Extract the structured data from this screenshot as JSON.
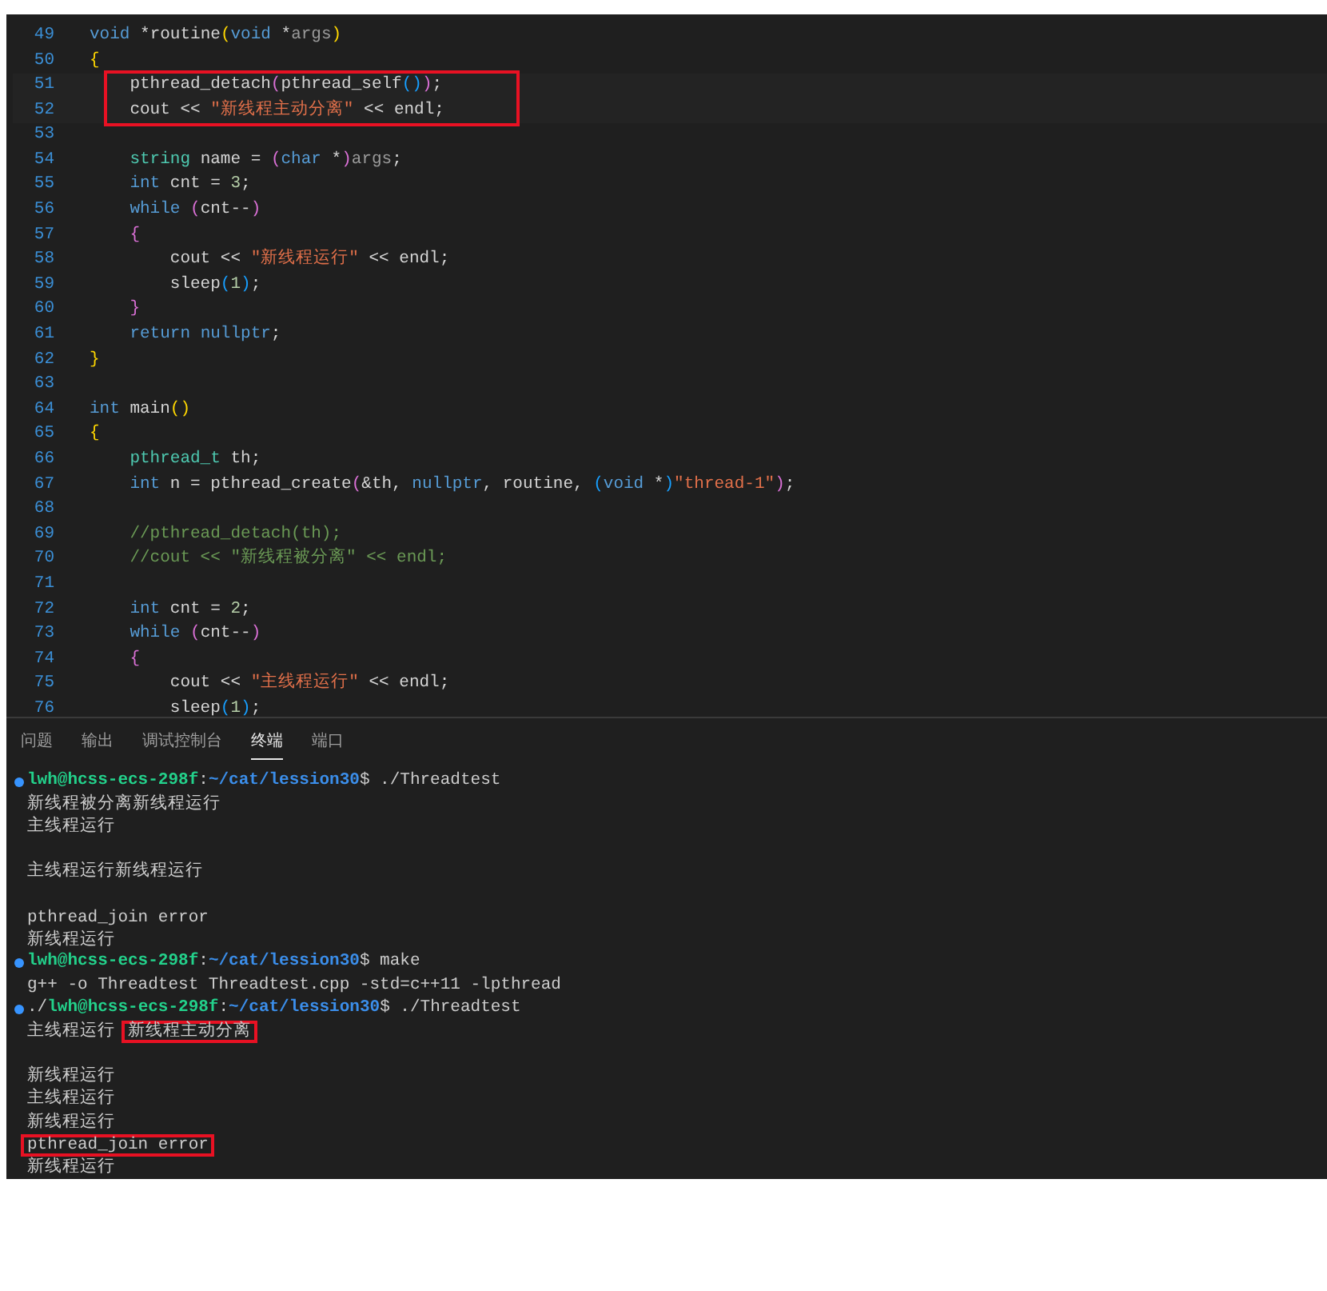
{
  "editor": {
    "lines": [
      {
        "number": "49",
        "tokens": [
          {
            "text": "void",
            "kind": "k"
          },
          {
            "text": " *routine",
            "kind": "p"
          },
          {
            "text": "(",
            "kind": "y"
          },
          {
            "text": "void",
            "kind": "k"
          },
          {
            "text": " *",
            "kind": "p"
          },
          {
            "text": "args",
            "kind": "d"
          },
          {
            "text": ")",
            "kind": "y"
          }
        ]
      },
      {
        "number": "50",
        "tokens": [
          {
            "text": "{",
            "kind": "y"
          }
        ]
      },
      {
        "number": "51",
        "highlighted": true,
        "tokens": [
          {
            "text": "    pthread_detach",
            "kind": "p"
          },
          {
            "text": "(",
            "kind": "m"
          },
          {
            "text": "pthread_self",
            "kind": "p"
          },
          {
            "text": "()",
            "kind": "b"
          },
          {
            "text": ")",
            "kind": "m"
          },
          {
            "text": ";",
            "kind": "p"
          }
        ]
      },
      {
        "number": "52",
        "highlighted": true,
        "tokens": [
          {
            "text": "    cout << ",
            "kind": "p"
          },
          {
            "text": "\"新线程主动分离\"",
            "kind": "s"
          },
          {
            "text": " << endl;",
            "kind": "p"
          }
        ]
      },
      {
        "number": "53"
      },
      {
        "number": "54",
        "tokens": [
          {
            "text": "    string",
            "kind": "t"
          },
          {
            "text": " name = ",
            "kind": "p"
          },
          {
            "text": "(",
            "kind": "m"
          },
          {
            "text": "char",
            "kind": "k"
          },
          {
            "text": " *",
            "kind": "p"
          },
          {
            "text": ")",
            "kind": "m"
          },
          {
            "text": "args",
            "kind": "d"
          },
          {
            "text": ";",
            "kind": "p"
          }
        ]
      },
      {
        "number": "55",
        "tokens": [
          {
            "text": "    int",
            "kind": "k"
          },
          {
            "text": " cnt = ",
            "kind": "p"
          },
          {
            "text": "3",
            "kind": "n"
          },
          {
            "text": ";",
            "kind": "p"
          }
        ]
      },
      {
        "number": "56",
        "tokens": [
          {
            "text": "    while ",
            "kind": "k"
          },
          {
            "text": "(",
            "kind": "m"
          },
          {
            "text": "cnt--",
            "kind": "p"
          },
          {
            "text": ")",
            "kind": "m"
          }
        ]
      },
      {
        "number": "57",
        "tokens": [
          {
            "text": "    {",
            "kind": "m"
          }
        ]
      },
      {
        "number": "58",
        "tokens": [
          {
            "text": "        cout << ",
            "kind": "p"
          },
          {
            "text": "\"新线程运行\"",
            "kind": "s"
          },
          {
            "text": " << endl;",
            "kind": "p"
          }
        ]
      },
      {
        "number": "59",
        "tokens": [
          {
            "text": "        sleep",
            "kind": "p"
          },
          {
            "text": "(",
            "kind": "b"
          },
          {
            "text": "1",
            "kind": "n"
          },
          {
            "text": ")",
            "kind": "b"
          },
          {
            "text": ";",
            "kind": "p"
          }
        ]
      },
      {
        "number": "60",
        "tokens": [
          {
            "text": "    }",
            "kind": "m"
          }
        ]
      },
      {
        "number": "61",
        "tokens": [
          {
            "text": "    return ",
            "kind": "k"
          },
          {
            "text": "nullptr",
            "kind": "k"
          },
          {
            "text": ";",
            "kind": "p"
          }
        ]
      },
      {
        "number": "62",
        "tokens": [
          {
            "text": "}",
            "kind": "y"
          }
        ]
      },
      {
        "number": "63"
      },
      {
        "number": "64",
        "tokens": [
          {
            "text": "int",
            "kind": "k"
          },
          {
            "text": " main",
            "kind": "p"
          },
          {
            "text": "()",
            "kind": "y"
          }
        ]
      },
      {
        "number": "65",
        "tokens": [
          {
            "text": "{",
            "kind": "y"
          }
        ]
      },
      {
        "number": "66",
        "tokens": [
          {
            "text": "    pthread_t",
            "kind": "t"
          },
          {
            "text": " th;",
            "kind": "p"
          }
        ]
      },
      {
        "number": "67",
        "tokens": [
          {
            "text": "    int",
            "kind": "k"
          },
          {
            "text": " n = pthread_create",
            "kind": "p"
          },
          {
            "text": "(",
            "kind": "m"
          },
          {
            "text": "&th, ",
            "kind": "p"
          },
          {
            "text": "nullptr",
            "kind": "k"
          },
          {
            "text": ", routine, ",
            "kind": "p"
          },
          {
            "text": "(",
            "kind": "b"
          },
          {
            "text": "void",
            "kind": "k"
          },
          {
            "text": " *",
            "kind": "p"
          },
          {
            "text": ")",
            "kind": "b"
          },
          {
            "text": "\"thread-1\"",
            "kind": "s"
          },
          {
            "text": ")",
            "kind": "m"
          },
          {
            "text": ";",
            "kind": "p"
          }
        ]
      },
      {
        "number": "68"
      },
      {
        "number": "69",
        "tokens": [
          {
            "text": "    //pthread_detach(th);",
            "kind": "c"
          }
        ]
      },
      {
        "number": "70",
        "tokens": [
          {
            "text": "    //cout << \"新线程被分离\" << endl;",
            "kind": "c"
          }
        ]
      },
      {
        "number": "71"
      },
      {
        "number": "72",
        "tokens": [
          {
            "text": "    int",
            "kind": "k"
          },
          {
            "text": " cnt = ",
            "kind": "p"
          },
          {
            "text": "2",
            "kind": "n"
          },
          {
            "text": ";",
            "kind": "p"
          }
        ]
      },
      {
        "number": "73",
        "tokens": [
          {
            "text": "    while ",
            "kind": "k"
          },
          {
            "text": "(",
            "kind": "m"
          },
          {
            "text": "cnt--",
            "kind": "p"
          },
          {
            "text": ")",
            "kind": "m"
          }
        ]
      },
      {
        "number": "74",
        "tokens": [
          {
            "text": "    {",
            "kind": "m"
          }
        ]
      },
      {
        "number": "75",
        "tokens": [
          {
            "text": "        cout << ",
            "kind": "p"
          },
          {
            "text": "\"主线程运行\"",
            "kind": "s"
          },
          {
            "text": " << endl;",
            "kind": "p"
          }
        ]
      },
      {
        "number": "76",
        "tokens": [
          {
            "text": "        sleep",
            "kind": "p"
          },
          {
            "text": "(",
            "kind": "b"
          },
          {
            "text": "1",
            "kind": "n"
          },
          {
            "text": ")",
            "kind": "b"
          },
          {
            "text": ";",
            "kind": "p"
          }
        ]
      }
    ]
  },
  "panel_tabs": [
    {
      "label": "问题",
      "selected": false
    },
    {
      "label": "输出",
      "selected": false
    },
    {
      "label": "调试控制台",
      "selected": false
    },
    {
      "label": "终端",
      "selected": true
    },
    {
      "label": "端口",
      "selected": false
    }
  ],
  "terminal": {
    "lines": [
      {
        "kind": "prompt",
        "user": "lwh@hcss-ecs-298f",
        "separator": ":",
        "path": "~/cat/lession30",
        "command": "$ ./Threadtest"
      },
      {
        "kind": "output",
        "segments": [
          {
            "text": "新线程被分离新线程运行",
            "boxed": false
          }
        ]
      },
      {
        "kind": "output",
        "segments": [
          {
            "text": "主线程运行",
            "boxed": false
          }
        ]
      },
      {
        "kind": "blank"
      },
      {
        "kind": "output",
        "segments": [
          {
            "text": "主线程运行新线程运行",
            "boxed": false
          }
        ]
      },
      {
        "kind": "blank"
      },
      {
        "kind": "output",
        "segments": [
          {
            "text": "pthread_join error",
            "boxed": false
          }
        ]
      },
      {
        "kind": "output",
        "segments": [
          {
            "text": "新线程运行",
            "boxed": false
          }
        ]
      },
      {
        "kind": "prompt",
        "user": "lwh@hcss-ecs-298f",
        "separator": ":",
        "path": "~/cat/lession30",
        "command": "$ make"
      },
      {
        "kind": "output",
        "segments": [
          {
            "text": "g++ -o Threadtest Threadtest.cpp -std=c++11 -lpthread",
            "boxed": false
          }
        ]
      },
      {
        "kind": "prompt",
        "prefix": "./",
        "user": "lwh@hcss-ecs-298f",
        "separator": ":",
        "path": "~/cat/lession30",
        "command": "$ ./Threadtest"
      },
      {
        "kind": "output",
        "segments": [
          {
            "text": "主线程运行",
            "boxed": false
          },
          {
            "text": "新线程主动分离",
            "boxed": true
          }
        ]
      },
      {
        "kind": "blank"
      },
      {
        "kind": "output",
        "segments": [
          {
            "text": "新线程运行",
            "boxed": false
          }
        ]
      },
      {
        "kind": "output",
        "segments": [
          {
            "text": "主线程运行",
            "boxed": false
          }
        ]
      },
      {
        "kind": "output",
        "segments": [
          {
            "text": "新线程运行",
            "boxed": false
          }
        ]
      },
      {
        "kind": "output",
        "segments": [
          {
            "text": "pthread_join error",
            "boxed": true
          }
        ]
      },
      {
        "kind": "output",
        "segments": [
          {
            "text": "新线程运行",
            "boxed": false
          }
        ]
      }
    ]
  }
}
